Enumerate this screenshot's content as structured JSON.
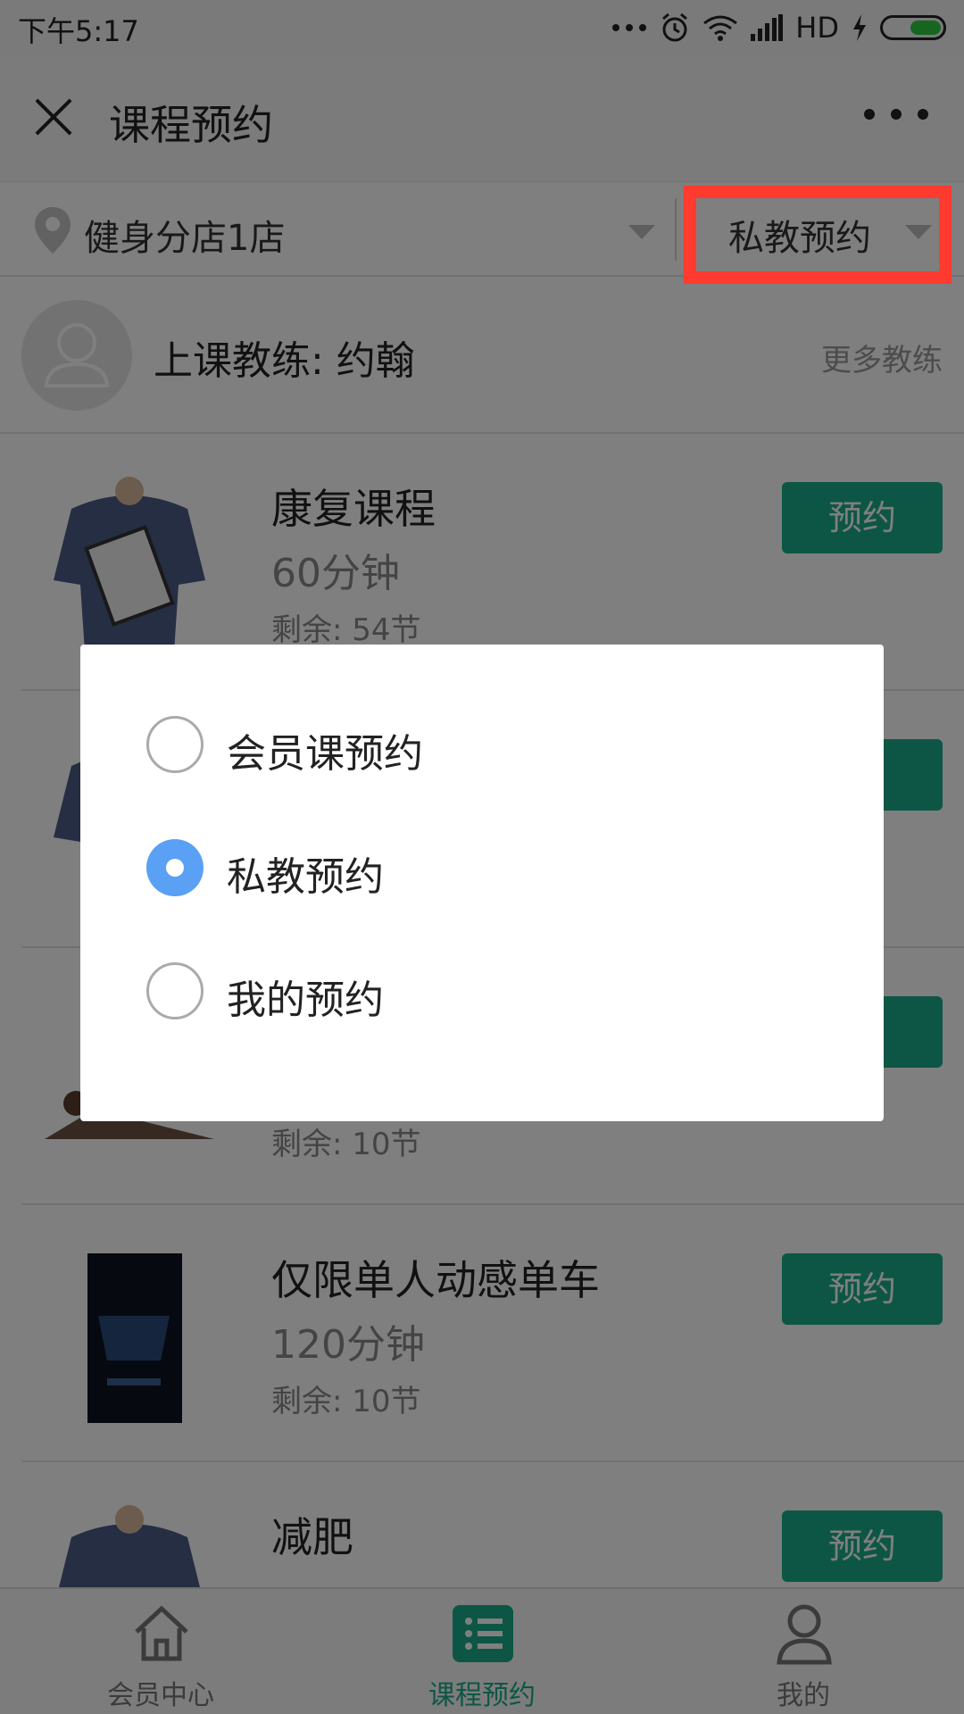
{
  "status_bar": {
    "time": "下午5:17",
    "network_label": "HD",
    "icons": [
      "more-dots-icon",
      "alarm-icon",
      "wifi-icon",
      "signal-icon",
      "charging-icon",
      "battery-icon"
    ]
  },
  "nav": {
    "title": "课程预约",
    "close_icon": "close-icon",
    "more_icon": "more-icon"
  },
  "filter": {
    "store": "健身分店1店",
    "type_selected": "私教预约"
  },
  "coach": {
    "label": "上课教练: 约翰",
    "more": "更多教练"
  },
  "courses": [
    {
      "name": "康复课程",
      "duration": "60分钟",
      "remaining": "剩余: 54节",
      "button": "预约"
    },
    {
      "name": "",
      "duration": "",
      "remaining": "",
      "button": ""
    },
    {
      "name": "",
      "duration": "",
      "remaining": "剩余: 10节",
      "button": ""
    },
    {
      "name": "仅限单人动感单车",
      "duration": "120分钟",
      "remaining": "剩余: 10节",
      "button": "预约"
    },
    {
      "name": "减肥",
      "duration": "",
      "remaining": "",
      "button": "预约"
    }
  ],
  "tabs": [
    {
      "label": "会员中心",
      "icon": "home-icon",
      "active": false
    },
    {
      "label": "课程预约",
      "icon": "list-icon",
      "active": true
    },
    {
      "label": "我的",
      "icon": "user-icon",
      "active": false
    }
  ],
  "dialog": {
    "options": [
      {
        "label": "会员课预约",
        "checked": false
      },
      {
        "label": "私教预约",
        "checked": true
      },
      {
        "label": "我的预约",
        "checked": false
      }
    ]
  },
  "colors": {
    "accent": "#1aad8b",
    "radio_checked": "#5aa0f5",
    "highlight": "#ff3b2f"
  }
}
